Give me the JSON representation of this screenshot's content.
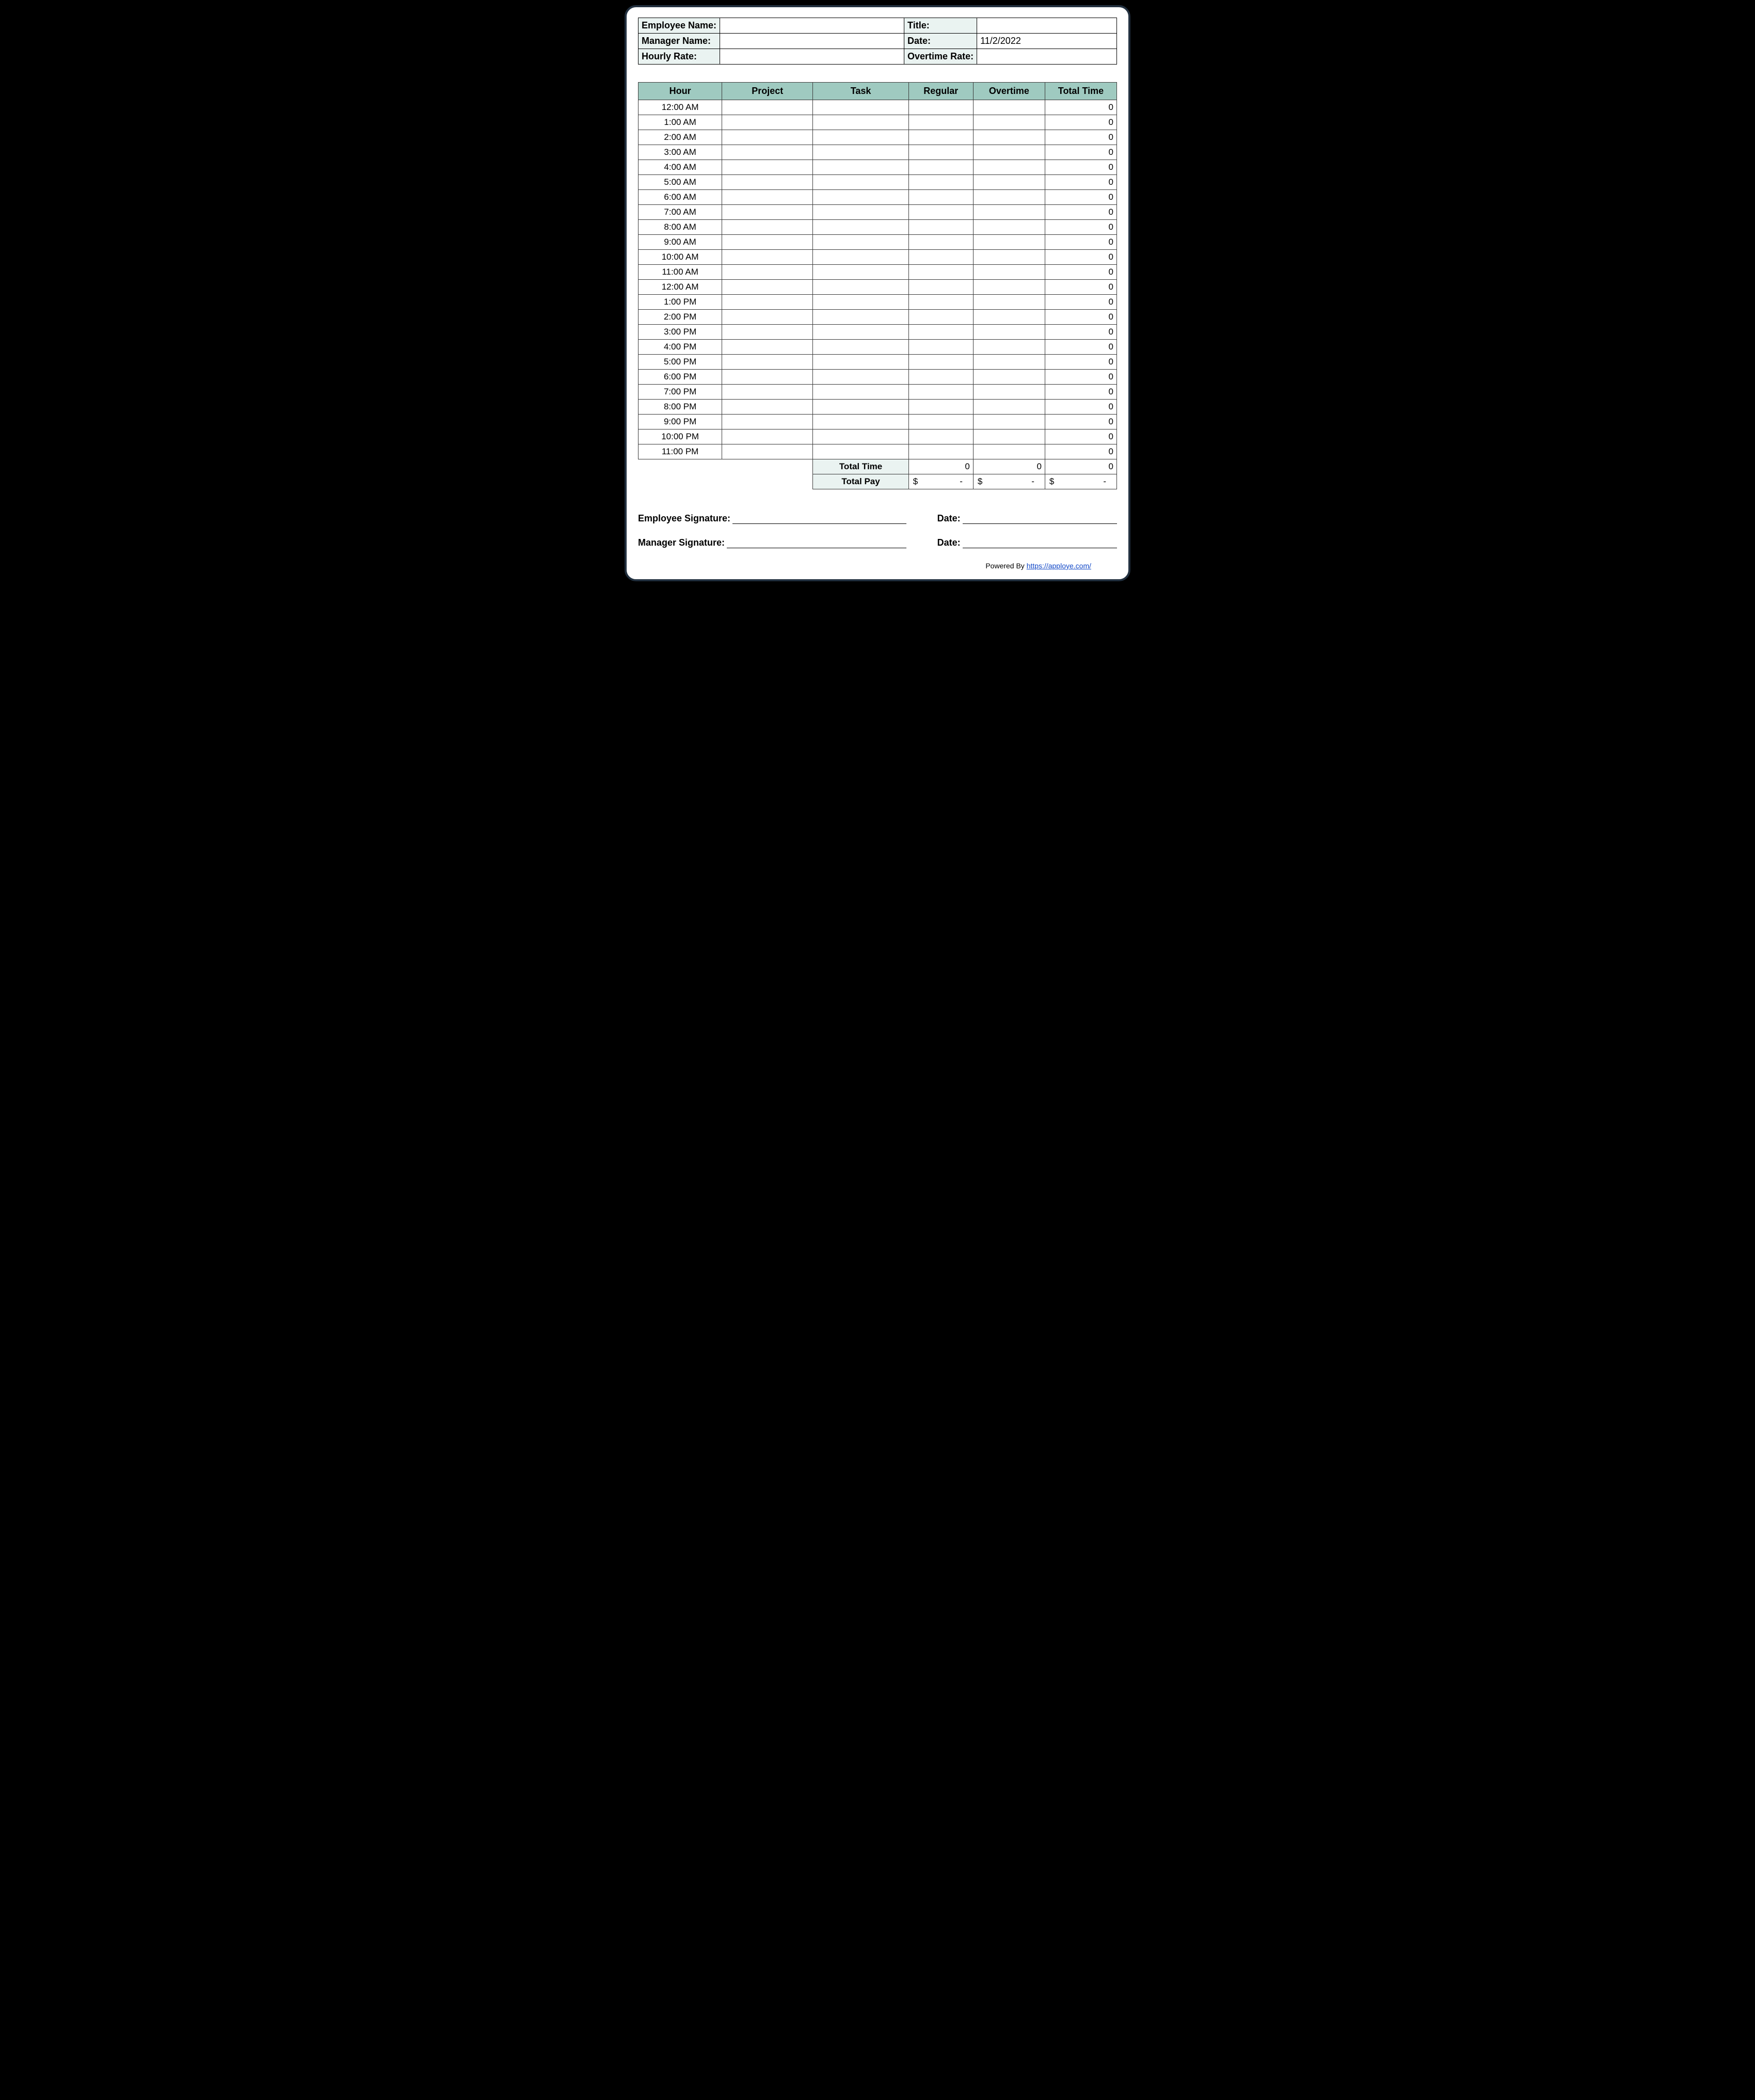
{
  "info": {
    "employee_name_label": "Employee Name:",
    "employee_name_value": "",
    "title_label": "Title:",
    "title_value": "",
    "manager_name_label": "Manager Name:",
    "manager_name_value": "",
    "date_label": "Date:",
    "date_value": "11/2/2022",
    "hourly_rate_label": "Hourly Rate:",
    "hourly_rate_value": "",
    "overtime_rate_label": "Overtime Rate:",
    "overtime_rate_value": ""
  },
  "grid": {
    "headers": {
      "hour": "Hour",
      "project": "Project",
      "task": "Task",
      "regular": "Regular",
      "overtime": "Overtime",
      "total": "Total Time"
    },
    "rows": [
      {
        "hour": "12:00 AM",
        "project": "",
        "task": "",
        "regular": "",
        "overtime": "",
        "total": "0"
      },
      {
        "hour": "1:00 AM",
        "project": "",
        "task": "",
        "regular": "",
        "overtime": "",
        "total": "0"
      },
      {
        "hour": "2:00 AM",
        "project": "",
        "task": "",
        "regular": "",
        "overtime": "",
        "total": "0"
      },
      {
        "hour": "3:00 AM",
        "project": "",
        "task": "",
        "regular": "",
        "overtime": "",
        "total": "0"
      },
      {
        "hour": "4:00 AM",
        "project": "",
        "task": "",
        "regular": "",
        "overtime": "",
        "total": "0"
      },
      {
        "hour": "5:00 AM",
        "project": "",
        "task": "",
        "regular": "",
        "overtime": "",
        "total": "0"
      },
      {
        "hour": "6:00 AM",
        "project": "",
        "task": "",
        "regular": "",
        "overtime": "",
        "total": "0"
      },
      {
        "hour": "7:00 AM",
        "project": "",
        "task": "",
        "regular": "",
        "overtime": "",
        "total": "0"
      },
      {
        "hour": "8:00 AM",
        "project": "",
        "task": "",
        "regular": "",
        "overtime": "",
        "total": "0"
      },
      {
        "hour": "9:00 AM",
        "project": "",
        "task": "",
        "regular": "",
        "overtime": "",
        "total": "0"
      },
      {
        "hour": "10:00 AM",
        "project": "",
        "task": "",
        "regular": "",
        "overtime": "",
        "total": "0"
      },
      {
        "hour": "11:00 AM",
        "project": "",
        "task": "",
        "regular": "",
        "overtime": "",
        "total": "0"
      },
      {
        "hour": "12:00 AM",
        "project": "",
        "task": "",
        "regular": "",
        "overtime": "",
        "total": "0"
      },
      {
        "hour": "1:00 PM",
        "project": "",
        "task": "",
        "regular": "",
        "overtime": "",
        "total": "0"
      },
      {
        "hour": "2:00 PM",
        "project": "",
        "task": "",
        "regular": "",
        "overtime": "",
        "total": "0"
      },
      {
        "hour": "3:00 PM",
        "project": "",
        "task": "",
        "regular": "",
        "overtime": "",
        "total": "0"
      },
      {
        "hour": "4:00 PM",
        "project": "",
        "task": "",
        "regular": "",
        "overtime": "",
        "total": "0"
      },
      {
        "hour": "5:00 PM",
        "project": "",
        "task": "",
        "regular": "",
        "overtime": "",
        "total": "0"
      },
      {
        "hour": "6:00 PM",
        "project": "",
        "task": "",
        "regular": "",
        "overtime": "",
        "total": "0"
      },
      {
        "hour": "7:00 PM",
        "project": "",
        "task": "",
        "regular": "",
        "overtime": "",
        "total": "0"
      },
      {
        "hour": "8:00 PM",
        "project": "",
        "task": "",
        "regular": "",
        "overtime": "",
        "total": "0"
      },
      {
        "hour": "9:00 PM",
        "project": "",
        "task": "",
        "regular": "",
        "overtime": "",
        "total": "0"
      },
      {
        "hour": "10:00 PM",
        "project": "",
        "task": "",
        "regular": "",
        "overtime": "",
        "total": "0"
      },
      {
        "hour": "11:00 PM",
        "project": "",
        "task": "",
        "regular": "",
        "overtime": "",
        "total": "0"
      }
    ],
    "totals": {
      "total_time_label": "Total Time",
      "regular_total": "0",
      "overtime_total": "0",
      "grand_total": "0",
      "total_pay_label": "Total Pay",
      "pay_currency": "$",
      "pay_dash": "-"
    }
  },
  "signatures": {
    "employee_label": "Employee Signature:",
    "manager_label": "Manager Signature:",
    "date_label": "Date:"
  },
  "footer": {
    "prefix": "Powered By ",
    "link_text": "https://apploye.com/"
  }
}
